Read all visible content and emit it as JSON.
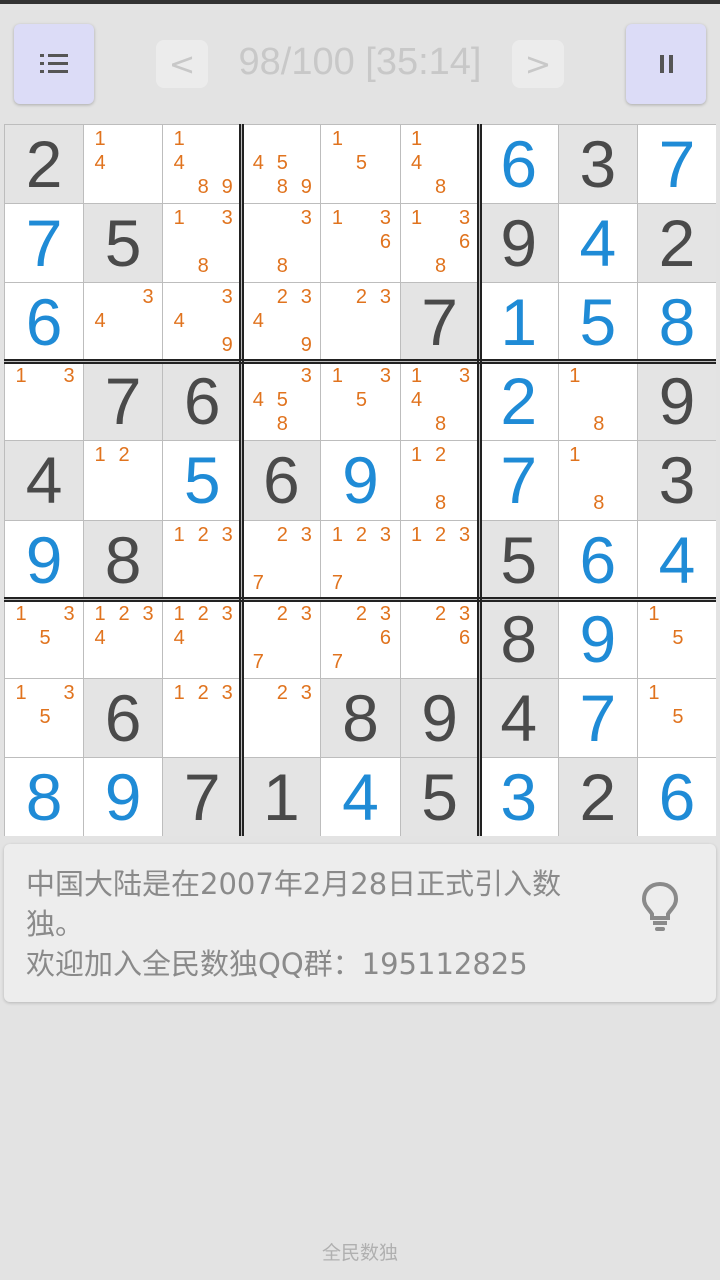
{
  "header": {
    "menu_icon": "list-icon",
    "pause_icon": "pause-icon",
    "prev_label": "<",
    "next_label": ">",
    "progress": "98/100 [35:14]"
  },
  "board": {
    "colors": {
      "given": "#4a4a4a",
      "user": "#1f8bd6",
      "candidate": "#e0731e",
      "given_bg": "#e4e4e4"
    },
    "rows": [
      [
        {
          "v": "2",
          "t": "given"
        },
        {
          "c": [
            1,
            4
          ]
        },
        {
          "c": [
            1,
            4,
            8,
            9
          ]
        },
        {
          "c": [
            4,
            5,
            8,
            9
          ]
        },
        {
          "c": [
            1,
            5
          ]
        },
        {
          "c": [
            1,
            4,
            8
          ]
        },
        {
          "v": "6",
          "t": "user"
        },
        {
          "v": "3",
          "t": "given"
        },
        {
          "v": "7",
          "t": "user"
        }
      ],
      [
        {
          "v": "7",
          "t": "user"
        },
        {
          "v": "5",
          "t": "given"
        },
        {
          "c": [
            1,
            3,
            8
          ]
        },
        {
          "c": [
            3,
            8
          ]
        },
        {
          "c": [
            1,
            3,
            6
          ]
        },
        {
          "c": [
            1,
            3,
            6,
            8
          ]
        },
        {
          "v": "9",
          "t": "given"
        },
        {
          "v": "4",
          "t": "user"
        },
        {
          "v": "2",
          "t": "given"
        }
      ],
      [
        {
          "v": "6",
          "t": "user"
        },
        {
          "c": [
            3,
            4
          ]
        },
        {
          "c": [
            3,
            4,
            9
          ]
        },
        {
          "c": [
            2,
            3,
            4,
            9
          ]
        },
        {
          "c": [
            2,
            3
          ]
        },
        {
          "v": "7",
          "t": "given"
        },
        {
          "v": "1",
          "t": "user"
        },
        {
          "v": "5",
          "t": "user"
        },
        {
          "v": "8",
          "t": "user"
        }
      ],
      [
        {
          "c": [
            1,
            3
          ]
        },
        {
          "v": "7",
          "t": "given"
        },
        {
          "v": "6",
          "t": "given"
        },
        {
          "c": [
            3,
            4,
            5,
            8
          ]
        },
        {
          "c": [
            1,
            3,
            5
          ]
        },
        {
          "c": [
            1,
            3,
            4,
            8
          ]
        },
        {
          "v": "2",
          "t": "user"
        },
        {
          "c": [
            1,
            8
          ]
        },
        {
          "v": "9",
          "t": "given"
        }
      ],
      [
        {
          "v": "4",
          "t": "given"
        },
        {
          "c": [
            1,
            2
          ]
        },
        {
          "v": "5",
          "t": "user"
        },
        {
          "v": "6",
          "t": "given"
        },
        {
          "v": "9",
          "t": "user"
        },
        {
          "c": [
            1,
            2,
            8
          ]
        },
        {
          "v": "7",
          "t": "user"
        },
        {
          "c": [
            1,
            8
          ]
        },
        {
          "v": "3",
          "t": "given"
        }
      ],
      [
        {
          "v": "9",
          "t": "user"
        },
        {
          "v": "8",
          "t": "given"
        },
        {
          "c": [
            1,
            2,
            3
          ]
        },
        {
          "c": [
            2,
            3,
            7
          ]
        },
        {
          "c": [
            1,
            2,
            3,
            7
          ]
        },
        {
          "c": [
            1,
            2,
            3
          ]
        },
        {
          "v": "5",
          "t": "given"
        },
        {
          "v": "6",
          "t": "user"
        },
        {
          "v": "4",
          "t": "user"
        }
      ],
      [
        {
          "c": [
            1,
            3,
            5
          ]
        },
        {
          "c": [
            1,
            2,
            3,
            4
          ]
        },
        {
          "c": [
            1,
            2,
            3,
            4
          ]
        },
        {
          "c": [
            2,
            3,
            7
          ]
        },
        {
          "c": [
            2,
            3,
            6,
            7
          ]
        },
        {
          "c": [
            2,
            3,
            6
          ]
        },
        {
          "v": "8",
          "t": "given"
        },
        {
          "v": "9",
          "t": "user"
        },
        {
          "c": [
            1,
            5
          ]
        }
      ],
      [
        {
          "c": [
            1,
            3,
            5
          ]
        },
        {
          "v": "6",
          "t": "given"
        },
        {
          "c": [
            1,
            2,
            3
          ]
        },
        {
          "c": [
            2,
            3
          ]
        },
        {
          "v": "8",
          "t": "given"
        },
        {
          "v": "9",
          "t": "given"
        },
        {
          "v": "4",
          "t": "given"
        },
        {
          "v": "7",
          "t": "user"
        },
        {
          "c": [
            1,
            5
          ]
        }
      ],
      [
        {
          "v": "8",
          "t": "user"
        },
        {
          "v": "9",
          "t": "user"
        },
        {
          "v": "7",
          "t": "given"
        },
        {
          "v": "1",
          "t": "given"
        },
        {
          "v": "4",
          "t": "user"
        },
        {
          "v": "5",
          "t": "given"
        },
        {
          "v": "3",
          "t": "user"
        },
        {
          "v": "2",
          "t": "given"
        },
        {
          "v": "6",
          "t": "user"
        }
      ]
    ]
  },
  "tip": {
    "line1": "中国大陆是在2007年2月28日正式引入数独。",
    "line2": "欢迎加入全民数独QQ群：195112825",
    "icon": "lightbulb-icon"
  },
  "footer": {
    "app_name": "全民数独"
  }
}
